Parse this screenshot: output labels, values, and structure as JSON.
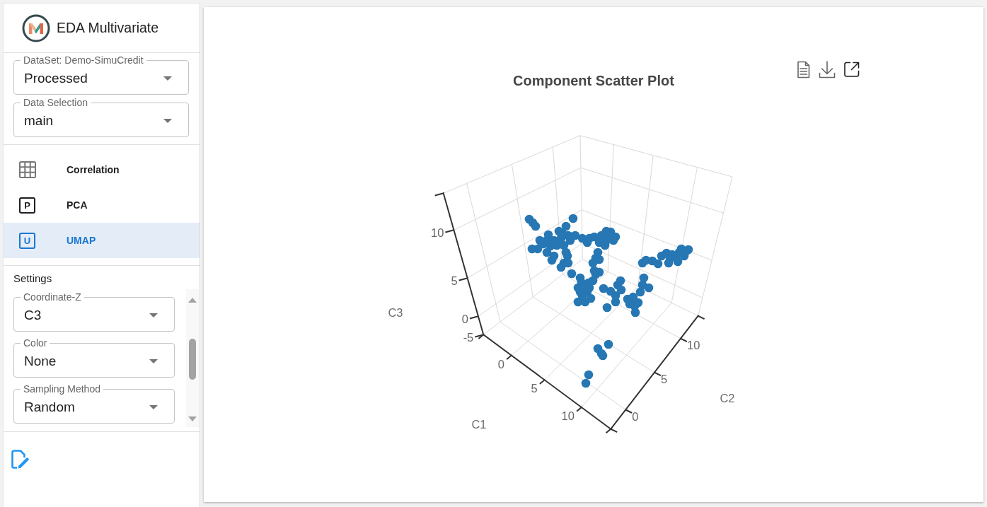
{
  "app": {
    "title": "EDA Multivariate"
  },
  "data_fields": [
    {
      "label": "DataSet: Demo-SimuCredit",
      "value": "Processed"
    },
    {
      "label": "Data Selection",
      "value": "main"
    }
  ],
  "nav": [
    {
      "label": "Correlation",
      "kind": "grid",
      "selected": false
    },
    {
      "label": "PCA",
      "kind": "letter",
      "letter": "P",
      "selected": false
    },
    {
      "label": "UMAP",
      "kind": "letter",
      "letter": "U",
      "selected": true
    }
  ],
  "settings": {
    "heading": "Settings",
    "fields": [
      {
        "label": "Coordinate-Z",
        "value": "C3"
      },
      {
        "label": "Color",
        "value": "None"
      },
      {
        "label": "Sampling Method",
        "value": "Random"
      }
    ]
  },
  "chart": {
    "title": "Component Scatter Plot",
    "axes": [
      {
        "name": "C1",
        "ticks": [
          "0",
          "5",
          "10"
        ]
      },
      {
        "name": "C2",
        "ticks": [
          "0",
          "5",
          "10"
        ]
      },
      {
        "name": "C3",
        "ticks": [
          "-5",
          "0",
          "5",
          "10"
        ]
      }
    ]
  }
}
